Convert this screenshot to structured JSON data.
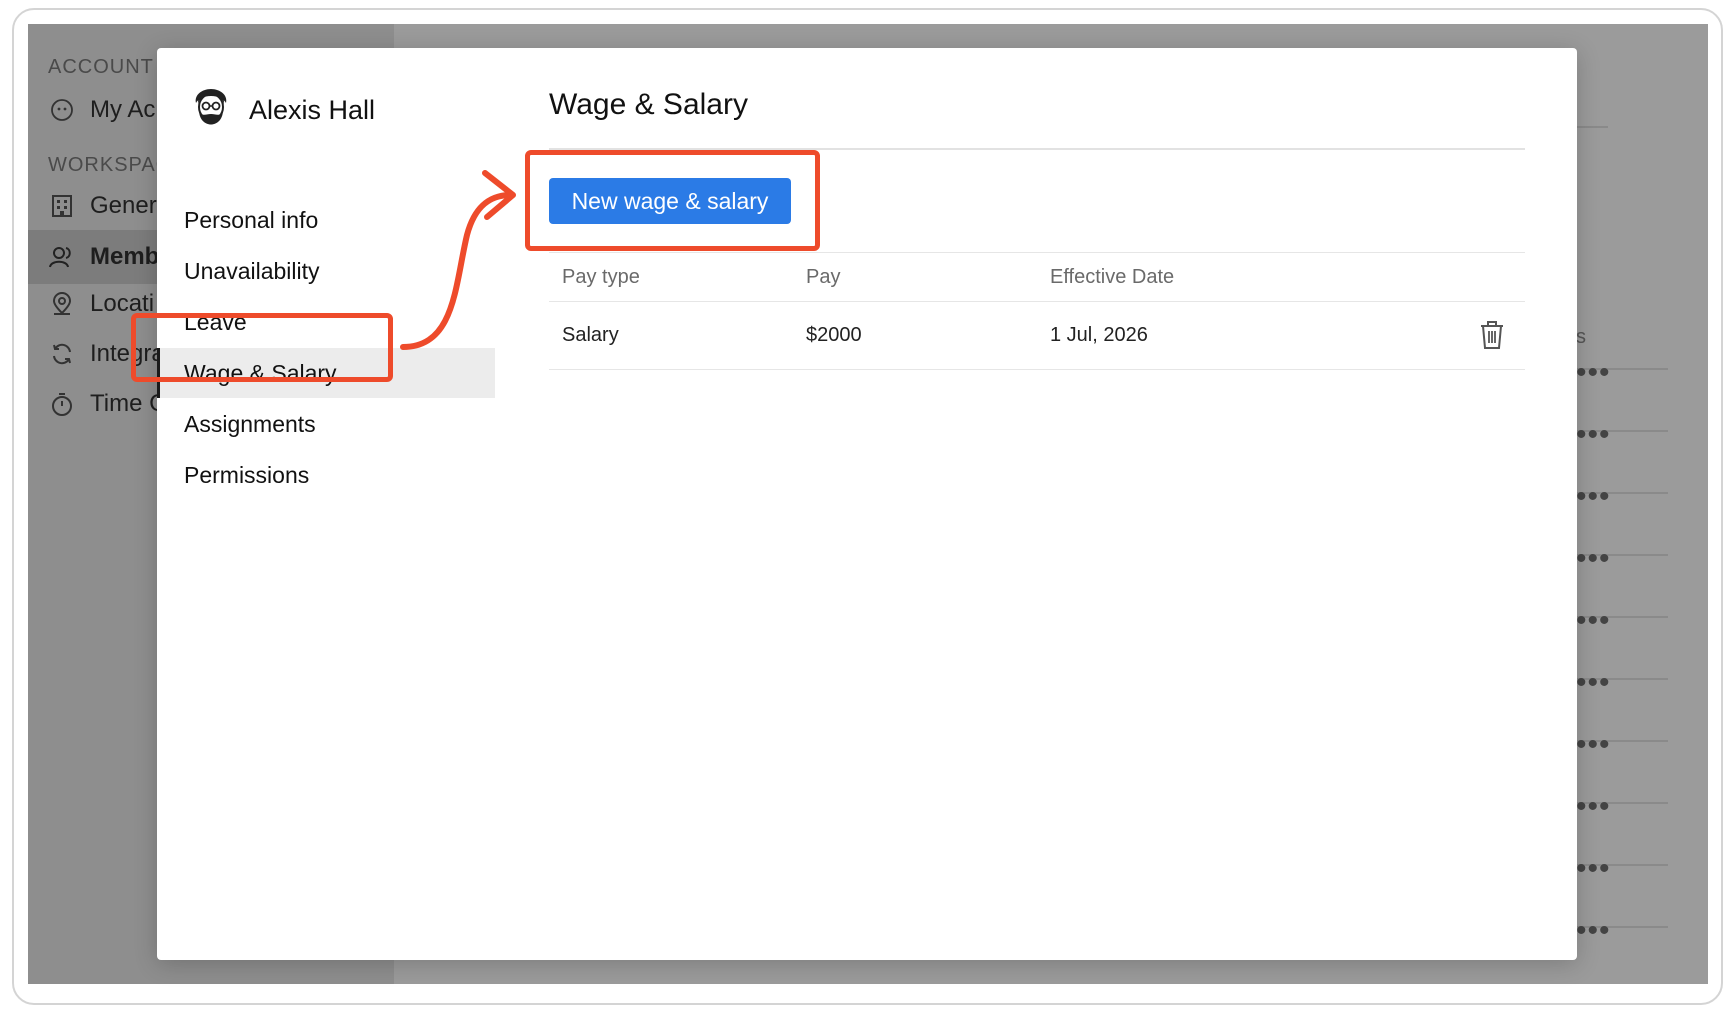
{
  "background_app": {
    "sections": [
      "ACCOUNT",
      "WORKSPAC"
    ],
    "items": [
      {
        "label": "My Ac",
        "icon": "account-icon"
      },
      {
        "label": "Gener",
        "icon": "building-icon"
      },
      {
        "label": "Memb",
        "icon": "members-icon"
      },
      {
        "label": "Locati",
        "icon": "location-icon"
      },
      {
        "label": "Integra",
        "icon": "sync-icon"
      },
      {
        "label": "Time C",
        "icon": "stopwatch-icon"
      }
    ],
    "row_more_label": "•••",
    "partial_header": "s"
  },
  "modal": {
    "profile_name": "Alexis Hall",
    "nav": [
      {
        "label": "Personal info"
      },
      {
        "label": "Unavailability"
      },
      {
        "label": "Leave"
      },
      {
        "label": "Wage & Salary"
      },
      {
        "label": "Assignments"
      },
      {
        "label": "Permissions"
      }
    ],
    "title": "Wage & Salary",
    "new_button_label": "New wage & salary",
    "table": {
      "headers": [
        "Pay type",
        "Pay",
        "Effective Date"
      ],
      "rows": [
        {
          "pay_type": "Salary",
          "pay": "$2000",
          "effective_date": "1 Jul, 2026"
        }
      ]
    }
  },
  "colors": {
    "accent": "#2b7be6",
    "annotation": "#ee4b2b",
    "overlay": "#9b9b9b"
  }
}
